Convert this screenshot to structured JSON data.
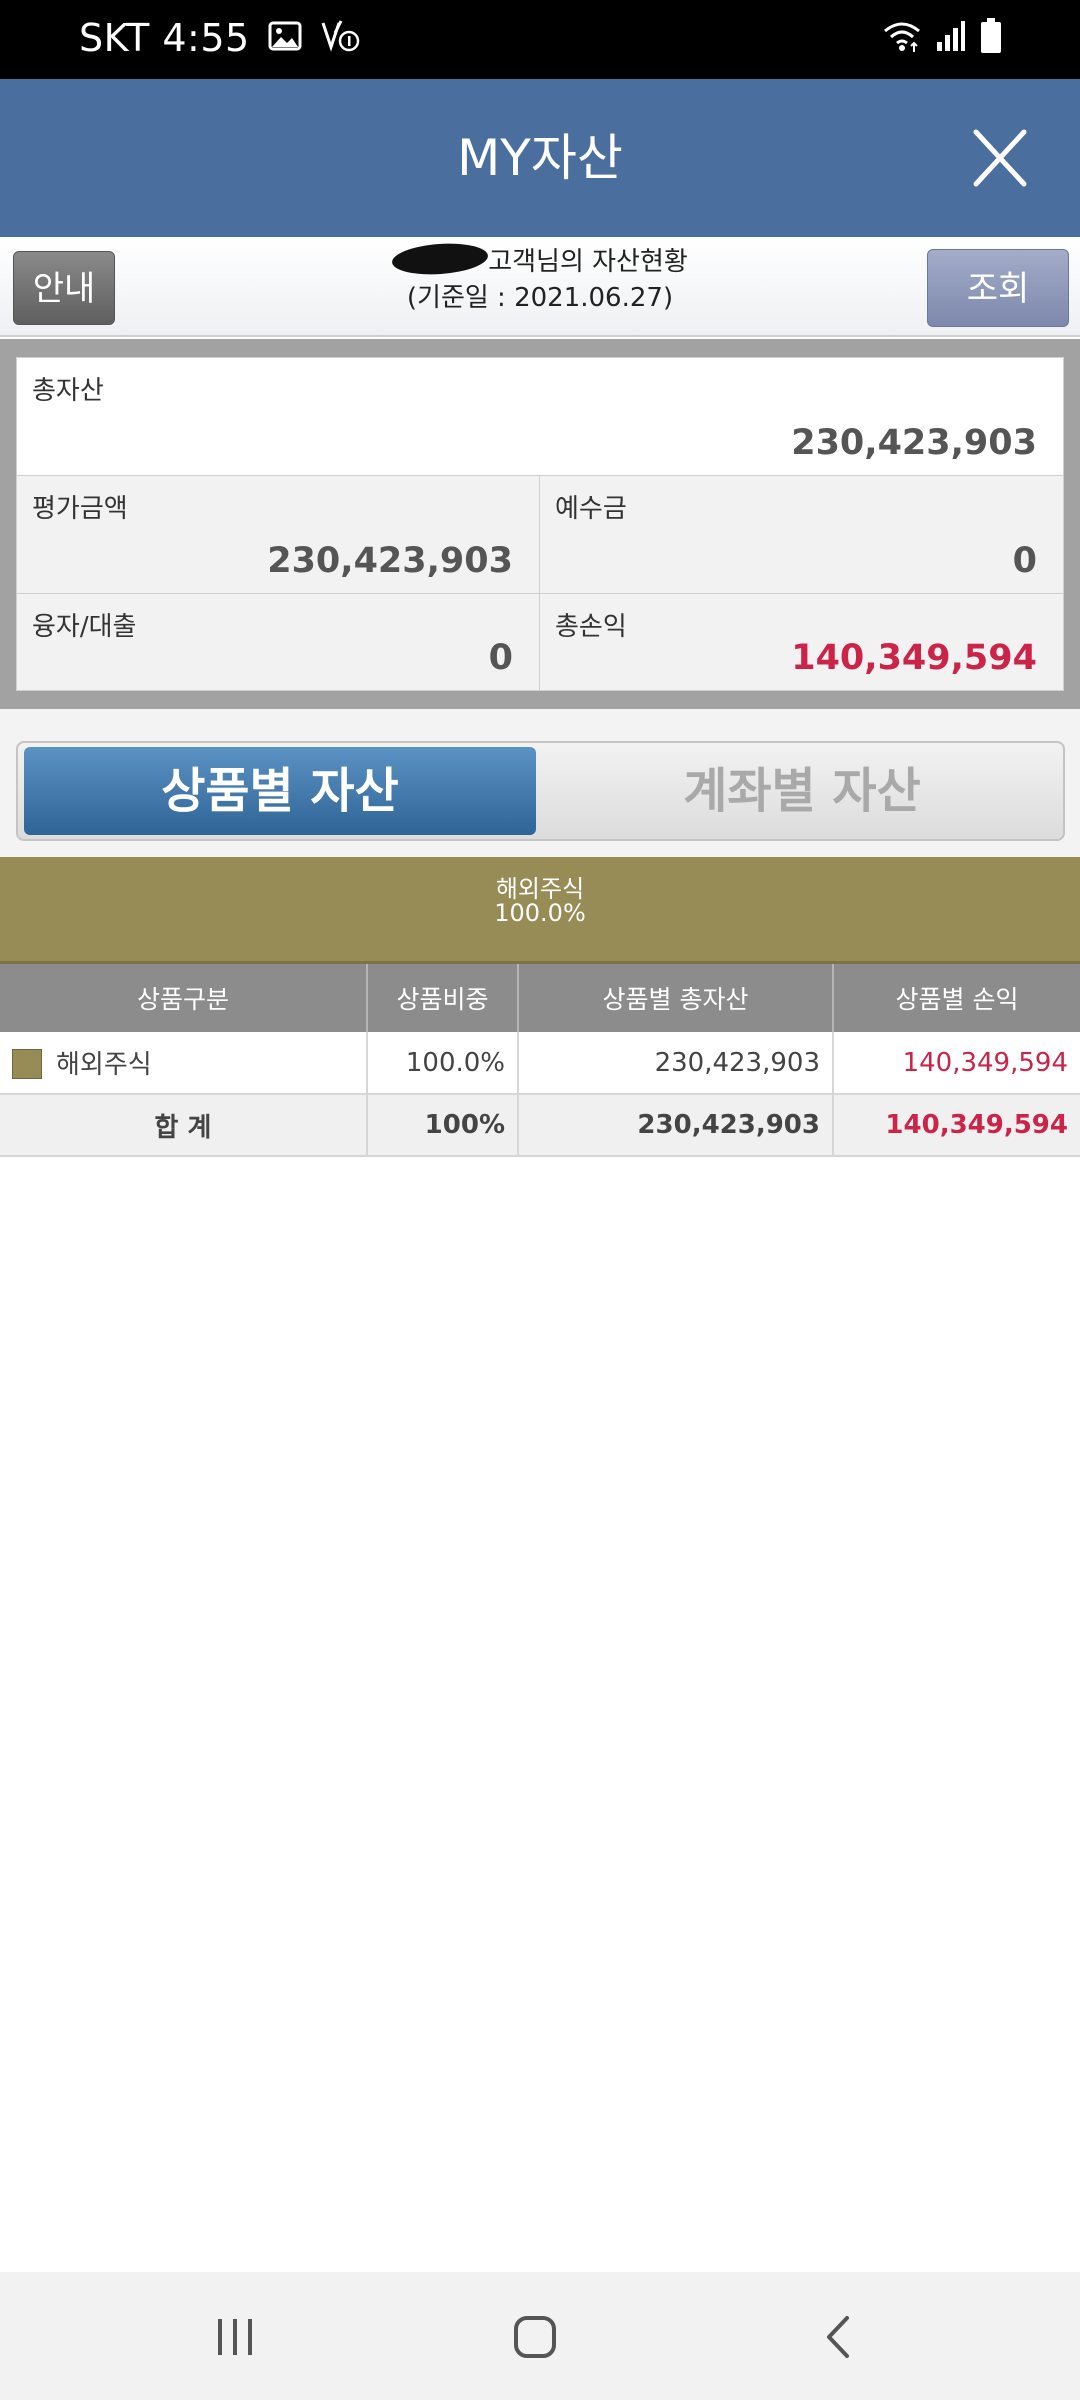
{
  "status_bar": {
    "carrier_time": "SKT 4:55",
    "left_icons": [
      "image-icon",
      "vpn-key-icon"
    ],
    "right_icons": [
      "wifi-icon",
      "signal-icon",
      "battery-icon"
    ]
  },
  "header": {
    "title": "MY자산",
    "close_icon": "close-icon",
    "color": "#4a6e9d"
  },
  "info_bar": {
    "guide_label": "안내",
    "query_label": "조회",
    "customer_suffix": "고객님의 자산현황",
    "base_date": "(기준일 : 2021.06.27)"
  },
  "summary": {
    "total_assets_label": "총자산",
    "total_assets_value": "230,423,903",
    "eval_amount_label": "평가금액",
    "eval_amount_value": "230,423,903",
    "deposit_label": "예수금",
    "deposit_value": "0",
    "loan_label": "융자/대출",
    "loan_value": "0",
    "total_pl_label": "총손익",
    "total_pl_value": "140,349,594"
  },
  "tabs": {
    "by_product": "상품별 자산",
    "by_account": "계좌별 자산",
    "active": "by_product"
  },
  "chart_band": {
    "label": "해외주식",
    "value": "100.0%",
    "color": "#978c56"
  },
  "table": {
    "headers": [
      "상품구분",
      "상품비중",
      "상품별 총자산",
      "상품별 손익"
    ],
    "rows": [
      {
        "name": "해외주식",
        "weight": "100.0%",
        "total": "230,423,903",
        "pl": "140,349,594"
      }
    ],
    "total_row": {
      "name": "합 계",
      "weight": "100%",
      "total": "230,423,903",
      "pl": "140,349,594"
    }
  },
  "nav_bar": {
    "buttons": [
      "recent-apps-icon",
      "home-icon",
      "back-icon"
    ]
  },
  "colors": {
    "profit_red": "#cc2448",
    "tab_active": "#3b74a8"
  }
}
